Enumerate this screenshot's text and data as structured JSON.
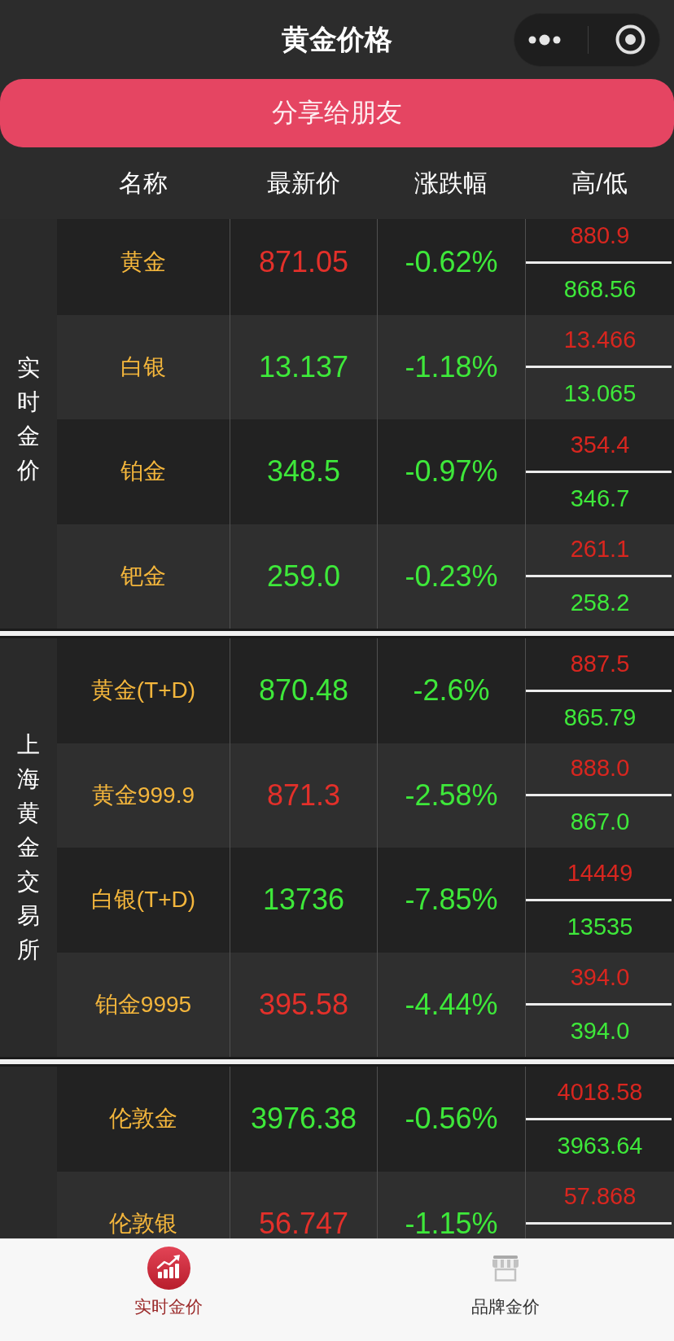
{
  "nav_bar": {
    "title": "黄金价格"
  },
  "share_button": {
    "label": "分享给朋友"
  },
  "table": {
    "columns": [
      "名称",
      "最新价",
      "涨跌幅",
      "高/低"
    ],
    "sections": [
      {
        "label": "实时金价",
        "rows": [
          {
            "name": "黄金",
            "price": {
              "text": "871.05",
              "color": "#e3302a"
            },
            "change": "-0.62%",
            "high": "880.9",
            "low": "868.56"
          },
          {
            "name": "白银",
            "price": {
              "text": "13.137",
              "color": "#3ee83a"
            },
            "change": "-1.18%",
            "high": "13.466",
            "low": "13.065"
          },
          {
            "name": "铂金",
            "price": {
              "text": "348.5",
              "color": "#3ee83a"
            },
            "change": "-0.97%",
            "high": "354.4",
            "low": "346.7"
          },
          {
            "name": "钯金",
            "price": {
              "text": "259.0",
              "color": "#3ee83a"
            },
            "change": "-0.23%",
            "high": "261.1",
            "low": "258.2"
          }
        ]
      },
      {
        "label": "上海黄金交易所",
        "rows": [
          {
            "name": "黄金(T+D)",
            "price": {
              "text": "870.48",
              "color": "#3ee83a"
            },
            "change": "-2.6%",
            "high": "887.5",
            "low": "865.79"
          },
          {
            "name": "黄金999.9",
            "price": {
              "text": "871.3",
              "color": "#e3302a"
            },
            "change": "-2.58%",
            "high": "888.0",
            "low": "867.0"
          },
          {
            "name": "白银(T+D)",
            "price": {
              "text": "13736",
              "color": "#3ee83a"
            },
            "change": "-7.85%",
            "high": "14449",
            "low": "13535"
          },
          {
            "name": "铂金9995",
            "price": {
              "text": "395.58",
              "color": "#e3302a"
            },
            "change": "-4.44%",
            "high": "394.0",
            "low": "394.0"
          }
        ]
      },
      {
        "rows": [
          {
            "name": "伦敦金",
            "price": {
              "text": "3976.38",
              "color": "#3ee83a"
            },
            "change": "-0.56%",
            "high": "4018.58",
            "low": "3963.64"
          },
          {
            "name": "伦敦银",
            "price": {
              "text": "56.747",
              "color": "#e3302a"
            },
            "change": "-1.15%",
            "high": "57.868"
          }
        ]
      }
    ]
  },
  "tab_bar": {
    "tabs": [
      {
        "label": "实时金价",
        "kind": "chart",
        "selected": true
      },
      {
        "label": "品牌金价",
        "kind": "store",
        "selected": false
      }
    ]
  }
}
